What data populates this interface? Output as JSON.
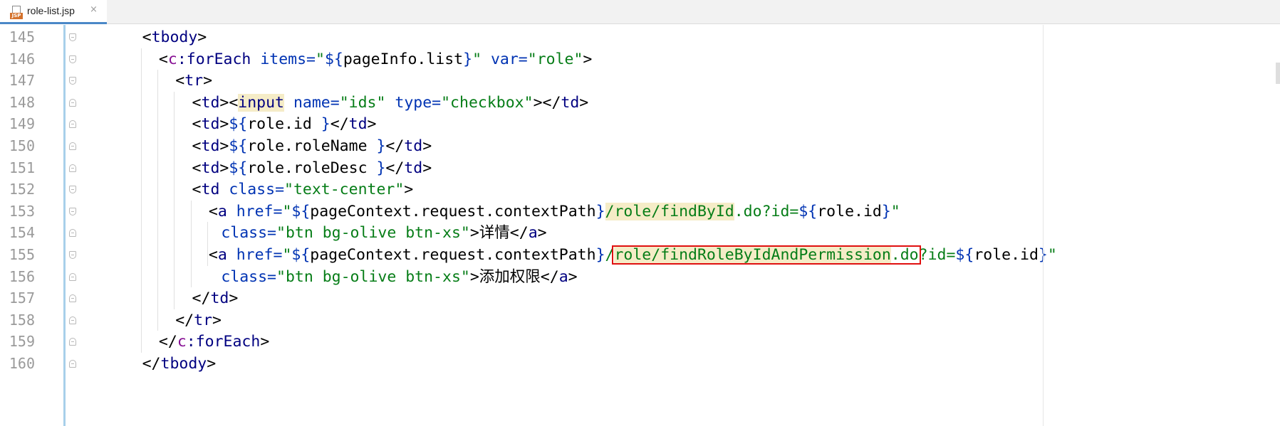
{
  "tab": {
    "filename": "role-list.jsp",
    "icon": "jsp-file-icon",
    "badge": "JSP",
    "close": "×"
  },
  "editor": {
    "lines": [
      {
        "n": "145",
        "indent": 4,
        "tokens": [
          [
            "br",
            "<"
          ],
          [
            "tg",
            "tbody"
          ],
          [
            "br",
            ">"
          ]
        ]
      },
      {
        "n": "146",
        "indent": 6,
        "tokens": [
          [
            "br",
            "<"
          ],
          [
            "ns",
            "c"
          ],
          [
            "tg",
            ":forEach "
          ],
          [
            "at",
            "items="
          ],
          [
            "st",
            "\""
          ],
          [
            "el",
            "${"
          ],
          [
            "tx",
            "pageInfo.list"
          ],
          [
            "el",
            "}"
          ],
          [
            "st",
            "\" "
          ],
          [
            "at",
            "var="
          ],
          [
            "st",
            "\"role\""
          ],
          [
            "br",
            ">"
          ]
        ]
      },
      {
        "n": "147",
        "indent": 8,
        "tokens": [
          [
            "br",
            "<"
          ],
          [
            "tg",
            "tr"
          ],
          [
            "br",
            ">"
          ]
        ]
      },
      {
        "n": "148",
        "indent": 10,
        "tokens": [
          [
            "br",
            "<"
          ],
          [
            "tg",
            "td"
          ],
          [
            "br",
            "><"
          ],
          [
            "tgh",
            "input"
          ],
          [
            "tx",
            " "
          ],
          [
            "at",
            "name="
          ],
          [
            "st",
            "\"ids\" "
          ],
          [
            "at",
            "type="
          ],
          [
            "st",
            "\"checkbox\""
          ],
          [
            "br",
            "></"
          ],
          [
            "tg",
            "td"
          ],
          [
            "br",
            ">"
          ]
        ]
      },
      {
        "n": "149",
        "indent": 10,
        "tokens": [
          [
            "br",
            "<"
          ],
          [
            "tg",
            "td"
          ],
          [
            "br",
            ">"
          ],
          [
            "el",
            "${"
          ],
          [
            "tx",
            "role.id "
          ],
          [
            "el",
            "}"
          ],
          [
            "br",
            "</"
          ],
          [
            "tg",
            "td"
          ],
          [
            "br",
            ">"
          ]
        ]
      },
      {
        "n": "150",
        "indent": 10,
        "tokens": [
          [
            "br",
            "<"
          ],
          [
            "tg",
            "td"
          ],
          [
            "br",
            ">"
          ],
          [
            "el",
            "${"
          ],
          [
            "tx",
            "role.roleName "
          ],
          [
            "el",
            "}"
          ],
          [
            "br",
            "</"
          ],
          [
            "tg",
            "td"
          ],
          [
            "br",
            ">"
          ]
        ]
      },
      {
        "n": "151",
        "indent": 10,
        "tokens": [
          [
            "br",
            "<"
          ],
          [
            "tg",
            "td"
          ],
          [
            "br",
            ">"
          ],
          [
            "el",
            "${"
          ],
          [
            "tx",
            "role.roleDesc "
          ],
          [
            "el",
            "}"
          ],
          [
            "br",
            "</"
          ],
          [
            "tg",
            "td"
          ],
          [
            "br",
            ">"
          ]
        ]
      },
      {
        "n": "152",
        "indent": 10,
        "tokens": [
          [
            "br",
            "<"
          ],
          [
            "tg",
            "td "
          ],
          [
            "at",
            "class="
          ],
          [
            "st",
            "\"text-center\""
          ],
          [
            "br",
            ">"
          ]
        ]
      },
      {
        "n": "153",
        "indent": 12,
        "tokens": [
          [
            "br",
            "<"
          ],
          [
            "tg",
            "a "
          ],
          [
            "at",
            "href="
          ],
          [
            "st",
            "\""
          ],
          [
            "el",
            "${"
          ],
          [
            "tx",
            "pageContext.request.contextPath"
          ],
          [
            "el",
            "}"
          ],
          [
            "sth",
            "/role/findById"
          ],
          [
            "st",
            ".do?id="
          ],
          [
            "el",
            "${"
          ],
          [
            "tx",
            "role.id"
          ],
          [
            "el",
            "}"
          ],
          [
            "st",
            "\""
          ]
        ]
      },
      {
        "n": "154",
        "indent": 13.5,
        "tokens": [
          [
            "at",
            "class="
          ],
          [
            "st",
            "\"btn bg-olive btn-xs\""
          ],
          [
            "br",
            ">"
          ],
          [
            "cjk",
            "详情"
          ],
          [
            "br",
            "</"
          ],
          [
            "tg",
            "a"
          ],
          [
            "br",
            ">"
          ]
        ]
      },
      {
        "n": "155",
        "indent": 12,
        "tokens": [
          [
            "br",
            "<"
          ],
          [
            "tg",
            "a "
          ],
          [
            "at",
            "href="
          ],
          [
            "st",
            "\""
          ],
          [
            "el",
            "${"
          ],
          [
            "tx",
            "pageContext.request.contextPath"
          ],
          [
            "el",
            "}"
          ],
          [
            "st",
            "/"
          ],
          [
            "sth",
            "role/findRoleByIdAndPermission"
          ],
          [
            "st",
            ".do"
          ],
          [
            "st",
            "?id="
          ],
          [
            "el",
            "${"
          ],
          [
            "tx",
            "role.id"
          ],
          [
            "el",
            "}"
          ],
          [
            "st",
            "\""
          ]
        ]
      },
      {
        "n": "156",
        "indent": 13.5,
        "tokens": [
          [
            "at",
            "class="
          ],
          [
            "st",
            "\"btn bg-olive btn-xs\""
          ],
          [
            "br",
            ">"
          ],
          [
            "cjk",
            "添加权限"
          ],
          [
            "br",
            "</"
          ],
          [
            "tg",
            "a"
          ],
          [
            "br",
            ">"
          ]
        ]
      },
      {
        "n": "157",
        "indent": 10,
        "tokens": [
          [
            "br",
            "</"
          ],
          [
            "tg",
            "td"
          ],
          [
            "br",
            ">"
          ]
        ]
      },
      {
        "n": "158",
        "indent": 8,
        "tokens": [
          [
            "br",
            "</"
          ],
          [
            "tg",
            "tr"
          ],
          [
            "br",
            ">"
          ]
        ]
      },
      {
        "n": "159",
        "indent": 6,
        "tokens": [
          [
            "br",
            "</"
          ],
          [
            "ns",
            "c"
          ],
          [
            "tg",
            ":forEach"
          ],
          [
            "br",
            ">"
          ]
        ]
      },
      {
        "n": "160",
        "indent": 4,
        "tokens": [
          [
            "br",
            "</"
          ],
          [
            "tg",
            "tbody"
          ],
          [
            "br",
            ">"
          ]
        ]
      }
    ]
  },
  "colors": {
    "highlight_box": "#e01010",
    "gutter_fold": "#a8d0ea"
  }
}
